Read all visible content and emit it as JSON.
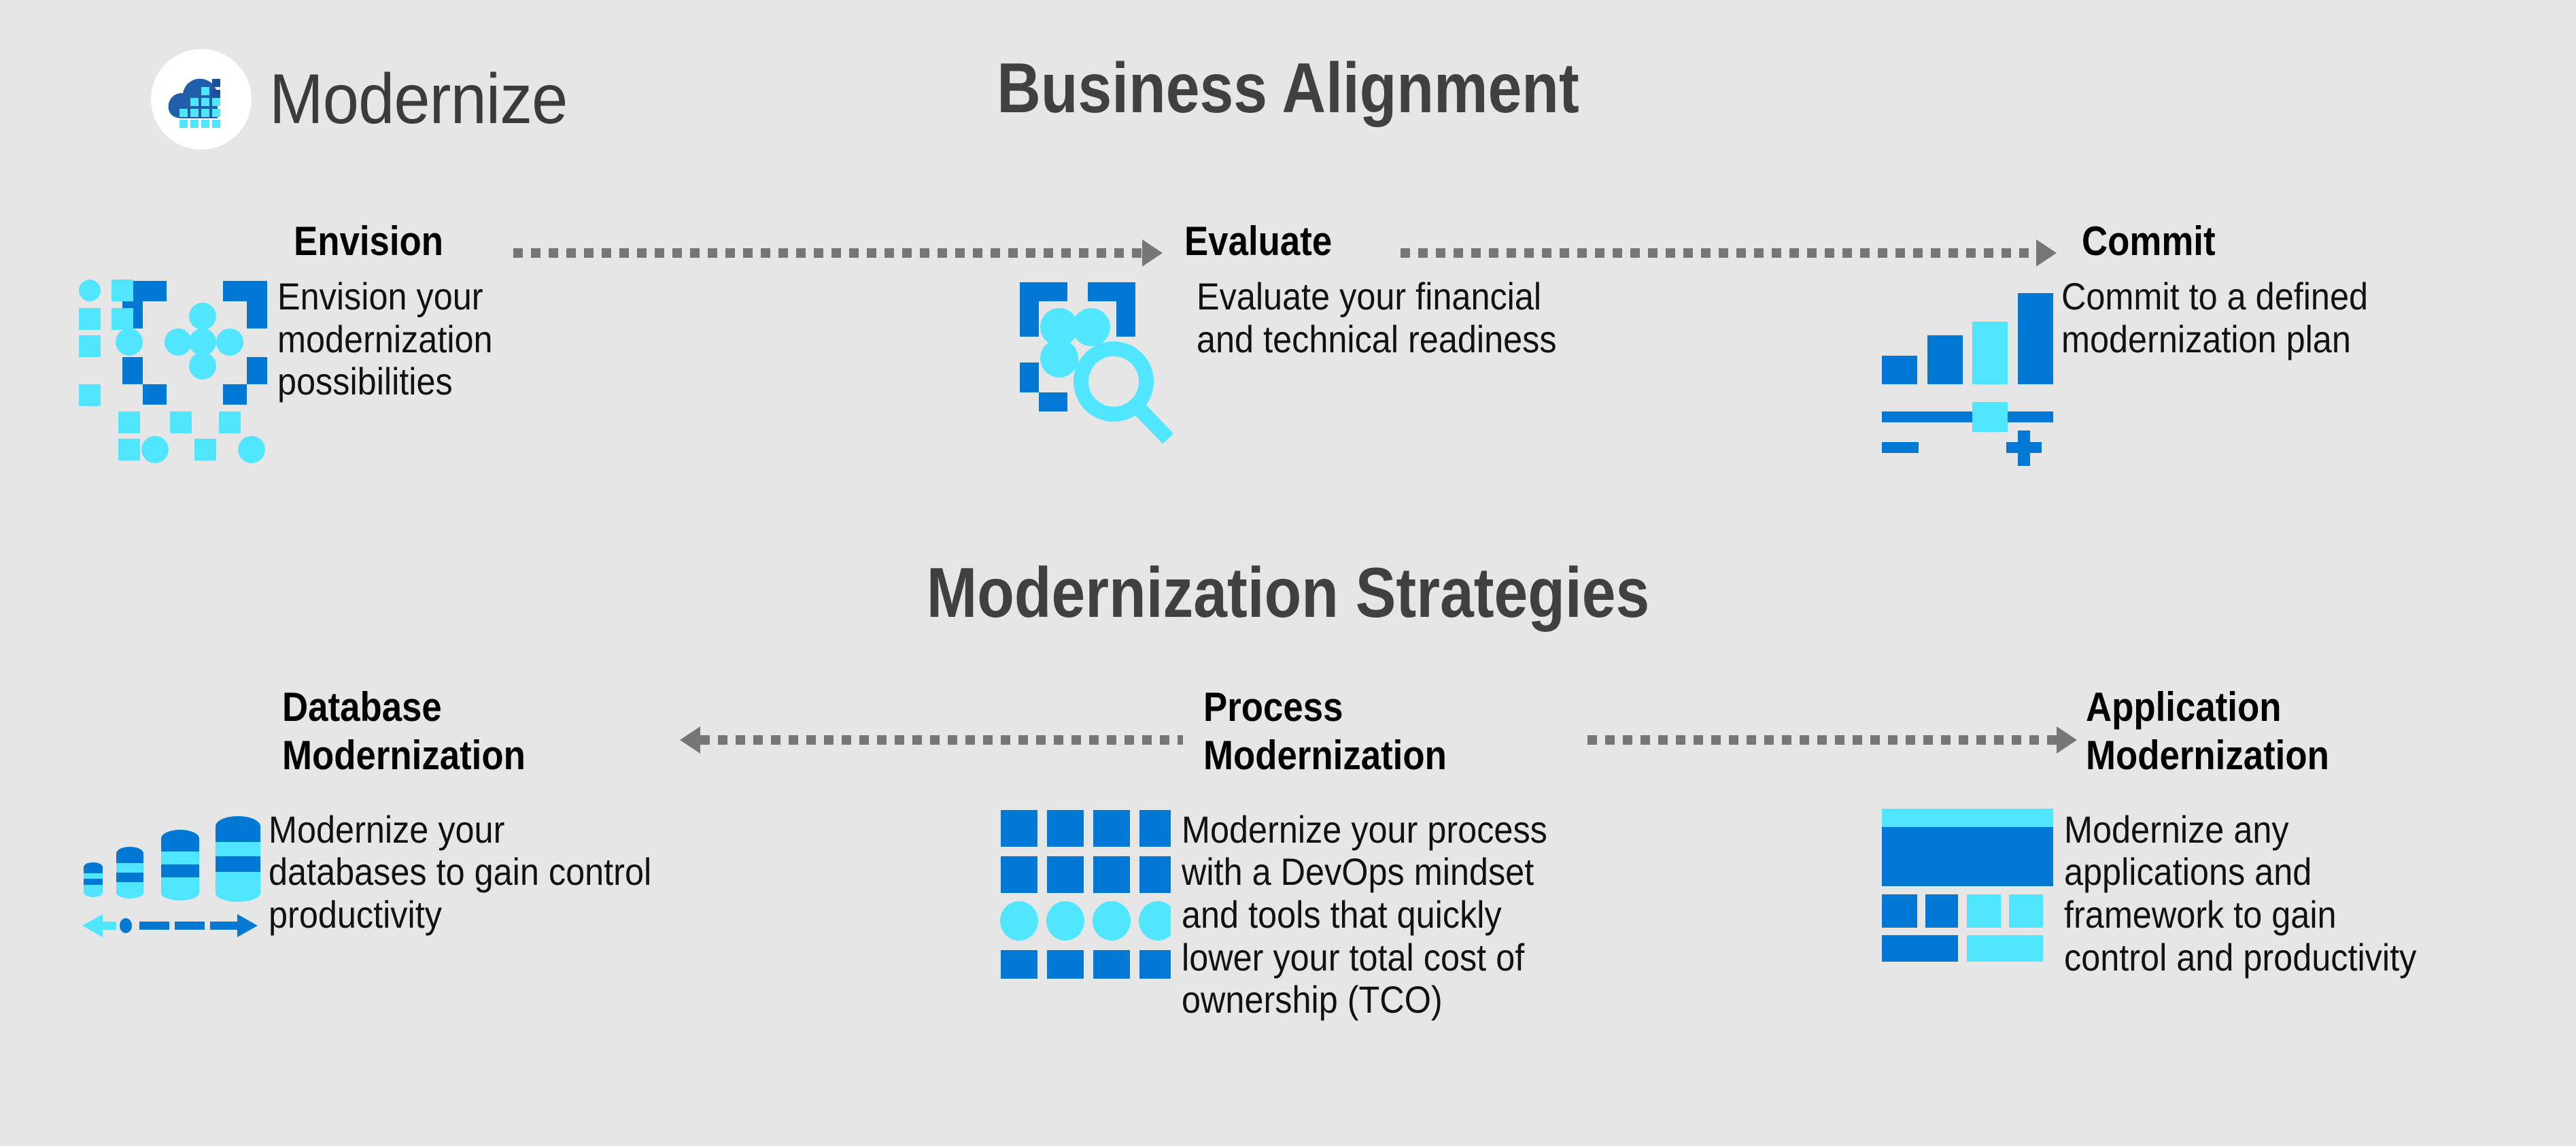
{
  "brand": {
    "name": "Modernize",
    "logo_icon": "cloud-data-logo-icon",
    "colors": {
      "cloud_dark": "#1F5EA8",
      "tile_cyan": "#50E6FF",
      "tile_dark": "#1B4F9C"
    }
  },
  "theme": {
    "background": "#E6E6E6",
    "primary_blue": "#0078D4",
    "accent_cyan": "#50E6FF",
    "title_gray": "#404040",
    "arrow_gray": "#767676",
    "heading_black": "#000000"
  },
  "sections": [
    {
      "id": "business-alignment",
      "title": "Business Alignment",
      "flow_direction": "left-to-right",
      "steps": [
        {
          "id": "envision",
          "heading": "Envision",
          "description": "Envision your\nmodernization\npossibilities",
          "icon": "dot-grid-scan-icon"
        },
        {
          "id": "evaluate",
          "heading": "Evaluate",
          "description": "Evaluate your financial\nand technical readiness",
          "icon": "scan-magnifier-icon"
        },
        {
          "id": "commit",
          "heading": "Commit",
          "description": "Commit to a defined\nmodernization plan",
          "icon": "bar-chart-slider-icon"
        }
      ],
      "connectors": [
        {
          "from": "envision",
          "to": "evaluate",
          "style": "dotted",
          "direction": "right"
        },
        {
          "from": "evaluate",
          "to": "commit",
          "style": "dotted",
          "direction": "right"
        }
      ]
    },
    {
      "id": "modernization-strategies",
      "title": "Modernization Strategies",
      "flow_direction": "converging-to-center",
      "steps": [
        {
          "id": "database-modernization",
          "heading": "Database\nModernization",
          "description": "Modernize your\ndatabases to gain control\nproductivity",
          "icon": "database-stack-icon"
        },
        {
          "id": "process-modernization",
          "heading": "Process\nModernization",
          "description": "Modernize your process\nwith a DevOps mindset\nand tools that quickly\nlower your total cost of\nownership (TCO)",
          "icon": "tile-grid-icon"
        },
        {
          "id": "application-modernization",
          "heading": "Application\nModernization",
          "description": "Modernize any\napplications and\nframework to gain\ncontrol and productivity",
          "icon": "app-layout-blocks-icon"
        }
      ],
      "connectors": [
        {
          "from": "process-modernization",
          "to": "database-modernization",
          "style": "dotted",
          "direction": "left"
        },
        {
          "from": "process-modernization",
          "to": "application-modernization",
          "style": "dotted",
          "direction": "right"
        }
      ]
    }
  ]
}
